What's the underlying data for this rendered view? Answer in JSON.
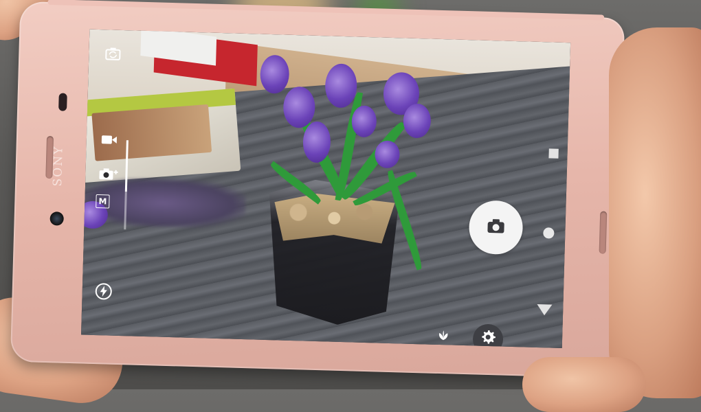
{
  "phone": {
    "brand": "SONY",
    "body_color": "#e6b6aa"
  },
  "camera_app": {
    "mode_label": "M",
    "icons": {
      "switch_camera": "camera-switch-icon",
      "video": "video-camera-icon",
      "photo_plus": "camera-plus-icon",
      "manual_mode": "manual-mode-icon",
      "flash": "flash-icon",
      "shutter": "camera-icon",
      "settings": "gear-icon",
      "scene": "plant-icon"
    },
    "shutter_color": "#f4f4f4",
    "settings_bg": "#3e3f44"
  }
}
